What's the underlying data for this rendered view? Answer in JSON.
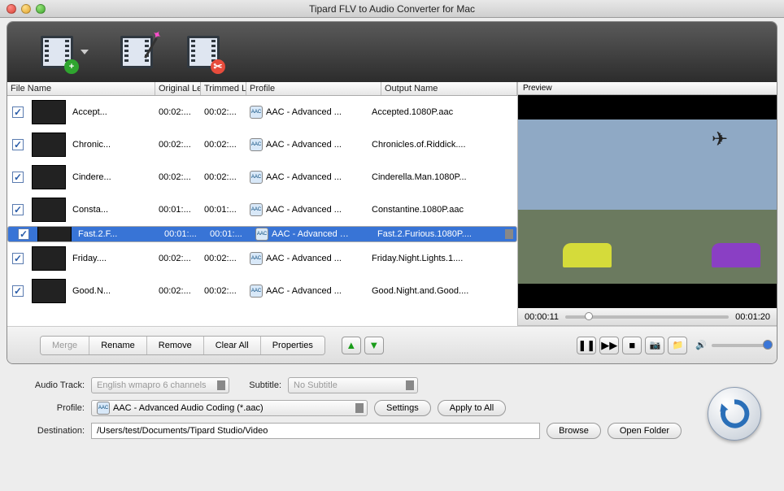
{
  "window": {
    "title": "Tipard FLV to Audio Converter for Mac"
  },
  "columns": {
    "filename": "File Name",
    "original": "Original Le",
    "trimmed": "Trimmed L",
    "profile": "Profile",
    "output": "Output Name"
  },
  "preview": {
    "label": "Preview",
    "current": "00:00:11",
    "total": "00:01:20"
  },
  "rows": [
    {
      "name": "Accept...",
      "ol": "00:02:...",
      "tl": "00:02:...",
      "prof": "AAC - Advanced ...",
      "out": "Accepted.1080P.aac"
    },
    {
      "name": "Chronic...",
      "ol": "00:02:...",
      "tl": "00:02:...",
      "prof": "AAC - Advanced ...",
      "out": "Chronicles.of.Riddick...."
    },
    {
      "name": "Cindere...",
      "ol": "00:02:...",
      "tl": "00:02:...",
      "prof": "AAC - Advanced ...",
      "out": "Cinderella.Man.1080P..."
    },
    {
      "name": "Consta...",
      "ol": "00:01:...",
      "tl": "00:01:...",
      "prof": "AAC - Advanced ...",
      "out": "Constantine.1080P.aac"
    },
    {
      "name": "Fast.2.F...",
      "ol": "00:01:...",
      "tl": "00:01:...",
      "prof": "AAC - Advanced …",
      "out": "Fast.2.Furious.1080P...."
    },
    {
      "name": "Friday....",
      "ol": "00:02:...",
      "tl": "00:02:...",
      "prof": "AAC - Advanced ...",
      "out": "Friday.Night.Lights.1...."
    },
    {
      "name": "Good.N...",
      "ol": "00:02:...",
      "tl": "00:02:...",
      "prof": "AAC - Advanced ...",
      "out": "Good.Night.and.Good...."
    }
  ],
  "buttons": {
    "merge": "Merge",
    "rename": "Rename",
    "remove": "Remove",
    "clearall": "Clear All",
    "properties": "Properties",
    "settings": "Settings",
    "applyall": "Apply to All",
    "browse": "Browse",
    "openfolder": "Open Folder"
  },
  "labels": {
    "audiotrack": "Audio Track:",
    "subtitle": "Subtitle:",
    "profile": "Profile:",
    "destination": "Destination:"
  },
  "values": {
    "audiotrack": "English wmapro 6 channels",
    "subtitle": "No Subtitle",
    "profile": "AAC - Advanced Audio Coding (*.aac)",
    "destination": "/Users/test/Documents/Tipard Studio/Video"
  }
}
